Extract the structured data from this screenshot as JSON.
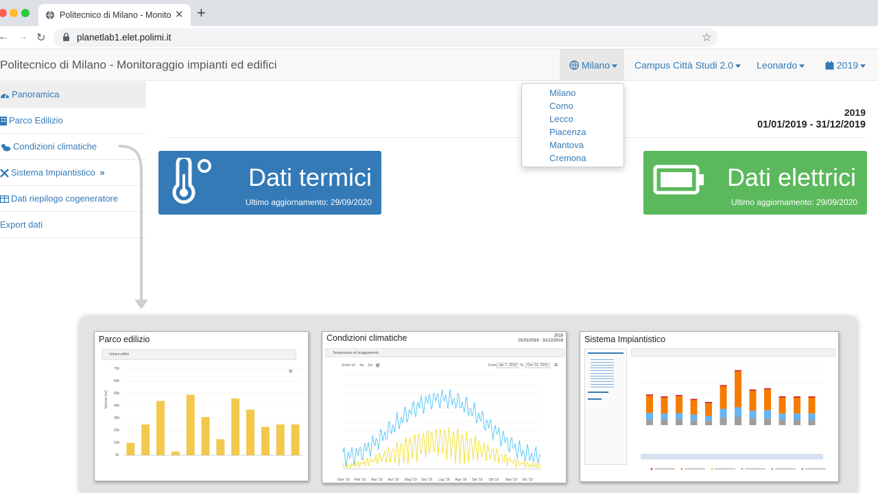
{
  "browser": {
    "tab_title": "Politecnico di Milano - Monitoraggio impianti ed edifici",
    "url": "planetlab1.elet.polimi.it"
  },
  "navbar": {
    "brand": "Politecnico di Milano - Monitoraggio impianti ed edifici",
    "city": "Milano",
    "campus": "Campus Città Studi 2.0",
    "building": "Leonardo",
    "year": "2019"
  },
  "city_dropdown": {
    "options": [
      "Milano",
      "Como",
      "Lecco",
      "Piacenza",
      "Mantova",
      "Cremona"
    ]
  },
  "sidebar": {
    "items": [
      {
        "label": "Panoramica",
        "icon": "dashboard-icon"
      },
      {
        "label": "Parco Edilizio",
        "icon": "building-icon"
      },
      {
        "label": "Condizioni climatiche",
        "icon": "cloud-sun-icon"
      },
      {
        "label": "Sistema Impiantistico",
        "icon": "tools-icon",
        "suffix": "»"
      },
      {
        "label": "Dati riepilogo cogeneratore",
        "icon": "table-icon"
      },
      {
        "label": "Export dati",
        "icon": ""
      }
    ]
  },
  "main": {
    "year": "2019",
    "range": "01/01/2019 - 31/12/2019",
    "thermal": {
      "title": "Dati termici",
      "updated": "Ultimo aggiornamento: 29/09/2020",
      "color": "#337ab7"
    },
    "electric": {
      "title": "Dati elettrici",
      "updated": "Ultimo aggiornamento: 29/09/2020",
      "color": "#5cb85c"
    }
  },
  "thumbnails": {
    "parco": {
      "title": "Parco edilizio",
      "panel": "Volumi edifici",
      "ylabel": "Volume [m³]",
      "yticks": [
        "70k",
        "60k",
        "50k",
        "40k",
        "30k",
        "20k",
        "10k",
        "0k"
      ],
      "bar_color": "#f2c94c"
    },
    "clima": {
      "title": "Condizioni climatiche",
      "year": "2019",
      "range": "01/01/2019 - 31/12/2019",
      "panel": "Temperatura ed irraggiamento",
      "zoom": "Zoom",
      "zoom_opts": [
        "1d",
        "1w",
        "1m",
        "all"
      ],
      "from": "From",
      "from_val": "Jan 1, 2019",
      "to": "To",
      "to_val": "Dec 31, 2019",
      "months": [
        "Gen '19",
        "Feb '19",
        "Mar '19",
        "Apr '19",
        "Mag '19",
        "Giu '19",
        "Lug '19",
        "Ago '19",
        "Set '19",
        "Ott '19",
        "Nov '19",
        "Dic '19"
      ]
    },
    "sistema": {
      "title": "Sistema Impiantistico"
    }
  }
}
